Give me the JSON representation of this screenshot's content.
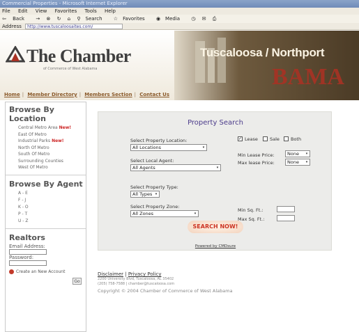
{
  "window": {
    "title": "Commercial Properties - Microsoft Internet Explorer"
  },
  "menu": [
    "File",
    "Edit",
    "View",
    "Favorites",
    "Tools",
    "Help"
  ],
  "toolbar": {
    "back": "Back",
    "forward": "→",
    "search": "Search",
    "favorites": "Favorites",
    "media": "Media"
  },
  "address": {
    "label": "Address",
    "url": "http://www.tuscaloosaites.com/"
  },
  "header": {
    "logo": "The Chamber",
    "logo_sub": "of Commerce of West Alabama",
    "city": "Tuscaloosa / Northport",
    "marquee": "BAMA",
    "nav": [
      "Home",
      "Member Directory",
      "Members Section",
      "Contact Us"
    ]
  },
  "sidebar": {
    "location_heading": "Browse By Location",
    "locations": [
      {
        "label": "Central Metro Area",
        "tag": "New!"
      },
      {
        "label": "East Of Metro",
        "tag": ""
      },
      {
        "label": "Industrial Parks",
        "tag": "New!"
      },
      {
        "label": "North Of Metro",
        "tag": ""
      },
      {
        "label": "South Of Metro",
        "tag": ""
      },
      {
        "label": "Surrounding Counties",
        "tag": ""
      },
      {
        "label": "West Of Metro",
        "tag": ""
      }
    ],
    "agent_heading": "Browse By Agent",
    "agents": [
      "A - E",
      "F - J",
      "K - O",
      "P - T",
      "U - Z"
    ],
    "realtors_heading": "Realtors",
    "email_label": "Email Address:",
    "password_label": "Password:",
    "go": "Go",
    "create_account": "Create an New Account"
  },
  "search": {
    "title": "Property Search",
    "location_label": "Select Property Location:",
    "location_value": "All Locations",
    "agent_label": "Select Local Agent:",
    "agent_value": "All Agents",
    "type_label": "Select Property Type:",
    "type_value": "All Types",
    "zone_label": "Select Property Zone:",
    "zone_value": "All Zones",
    "lease_label": "Lease",
    "sale_label": "Sale",
    "both_label": "Both",
    "lease_checked": true,
    "min_lease_label": "Min Lease Price:",
    "min_lease_value": "None",
    "max_lease_label": "Max lease Price:",
    "max_lease_value": "None",
    "min_sqft_label": "Min Sq. Ft.:",
    "max_sqft_label": "Max Sq. Ft.:",
    "button": "SEARCH NOW!",
    "powered": "Powered by CMDsure"
  },
  "footer": {
    "disclaimer": "Disclaimer",
    "privacy": "Privacy Policy",
    "address": "2200 University Blvd, Tuscaloosa, AL 35402",
    "phone": "(205) 758-7588 | chamber@tuscaloosa.com",
    "copyright": "Copyright © 2004 Chamber of Commerce of West Alabama"
  },
  "colors": {
    "accent": "#4a3a8a",
    "new_tag": "#cc2222",
    "button_text": "#cc3322"
  }
}
